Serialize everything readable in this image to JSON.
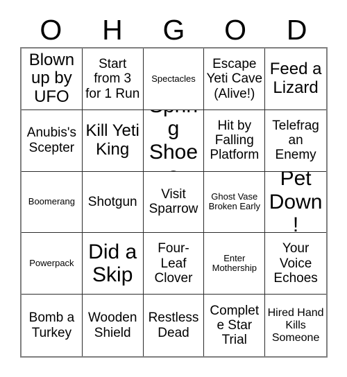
{
  "card": {
    "header_letters": [
      "O",
      "H",
      "G",
      "O",
      "D"
    ],
    "columns": 5,
    "rows": 5,
    "colors": {
      "background": "#ffffff",
      "text": "#000000",
      "inner_border": "#2b2b2b",
      "outer_border": "#808080"
    },
    "cells": [
      {
        "text": "Blown up by UFO",
        "size": "lg"
      },
      {
        "text": "Start from 3 for 1 Run",
        "size": "md"
      },
      {
        "text": "Spectacles",
        "size": "xs"
      },
      {
        "text": "Escape Yeti Cave (Alive!)",
        "size": "md"
      },
      {
        "text": "Feed a Lizard",
        "size": "lg"
      },
      {
        "text": "Anubis's Scepter",
        "size": "md"
      },
      {
        "text": "Kill Yeti King",
        "size": "lg"
      },
      {
        "text": "Spring Shoes",
        "size": "xl"
      },
      {
        "text": "Hit by Falling Platform",
        "size": "md"
      },
      {
        "text": "Telefrag an Enemy",
        "size": "md"
      },
      {
        "text": "Boomerang",
        "size": "xs"
      },
      {
        "text": "Shotgun",
        "size": "md"
      },
      {
        "text": "Visit Sparrow",
        "size": "md"
      },
      {
        "text": "Ghost Vase Broken Early",
        "size": "xs"
      },
      {
        "text": "Pet Down!",
        "size": "xl"
      },
      {
        "text": "Powerpack",
        "size": "xs"
      },
      {
        "text": "Did a Skip",
        "size": "xl"
      },
      {
        "text": "Four-Leaf Clover",
        "size": "md"
      },
      {
        "text": "Enter Mothership",
        "size": "xs"
      },
      {
        "text": "Your Voice Echoes",
        "size": "md"
      },
      {
        "text": "Bomb a Turkey",
        "size": "md"
      },
      {
        "text": "Wooden Shield",
        "size": "md"
      },
      {
        "text": "Restless Dead",
        "size": "md"
      },
      {
        "text": "Complete Star Trial",
        "size": "md"
      },
      {
        "text": "Hired Hand Kills Someone",
        "size": "sm"
      }
    ]
  }
}
